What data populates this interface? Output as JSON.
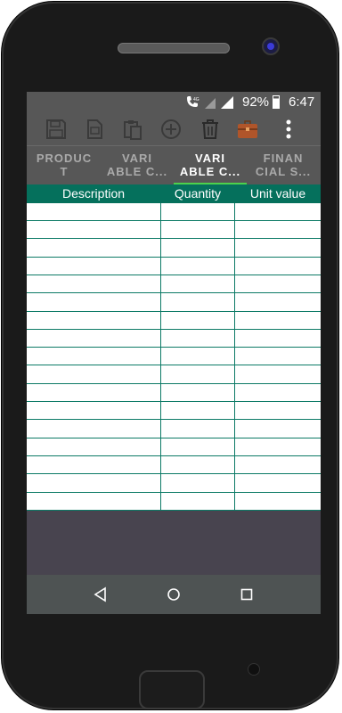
{
  "status_bar": {
    "battery_percent": "92%",
    "time": "6:47",
    "network_label": "4G"
  },
  "toolbar": {
    "icons": [
      "save-icon",
      "document-icon",
      "paste-icon",
      "add-circle-icon",
      "trash-icon",
      "briefcase-icon",
      "more-vert-icon"
    ]
  },
  "tabs": [
    {
      "line1": "PRODUC",
      "line2": "T"
    },
    {
      "line1": "VARI",
      "line2": "ABLE C..."
    },
    {
      "line1": "VARI",
      "line2": "ABLE C..."
    },
    {
      "line1": "FINAN",
      "line2": "CIAL S..."
    }
  ],
  "active_tab_index": 2,
  "table": {
    "headers": [
      "Description",
      "Quantity",
      "Unit value"
    ],
    "rows": [
      [
        "",
        "",
        ""
      ],
      [
        "",
        "",
        ""
      ],
      [
        "",
        "",
        ""
      ],
      [
        "",
        "",
        ""
      ],
      [
        "",
        "",
        ""
      ],
      [
        "",
        "",
        ""
      ],
      [
        "",
        "",
        ""
      ],
      [
        "",
        "",
        ""
      ],
      [
        "",
        "",
        ""
      ],
      [
        "",
        "",
        ""
      ],
      [
        "",
        "",
        ""
      ],
      [
        "",
        "",
        ""
      ],
      [
        "",
        "",
        ""
      ],
      [
        "",
        "",
        ""
      ],
      [
        "",
        "",
        ""
      ],
      [
        "",
        "",
        ""
      ],
      [
        "",
        "",
        ""
      ]
    ]
  },
  "navigation": {
    "icons": [
      "back-icon",
      "home-icon",
      "recents-icon"
    ]
  },
  "colors": {
    "header_bg": "#05705c",
    "grid_line": "#0c7a66",
    "bar_bg": "#575757",
    "tab_indicator": "#4cd14c",
    "tab_active_text": "#ffffff",
    "tab_inactive_text": "#aaaaaa",
    "empty_area": "#48444f",
    "nav_bar": "#4e5353"
  }
}
